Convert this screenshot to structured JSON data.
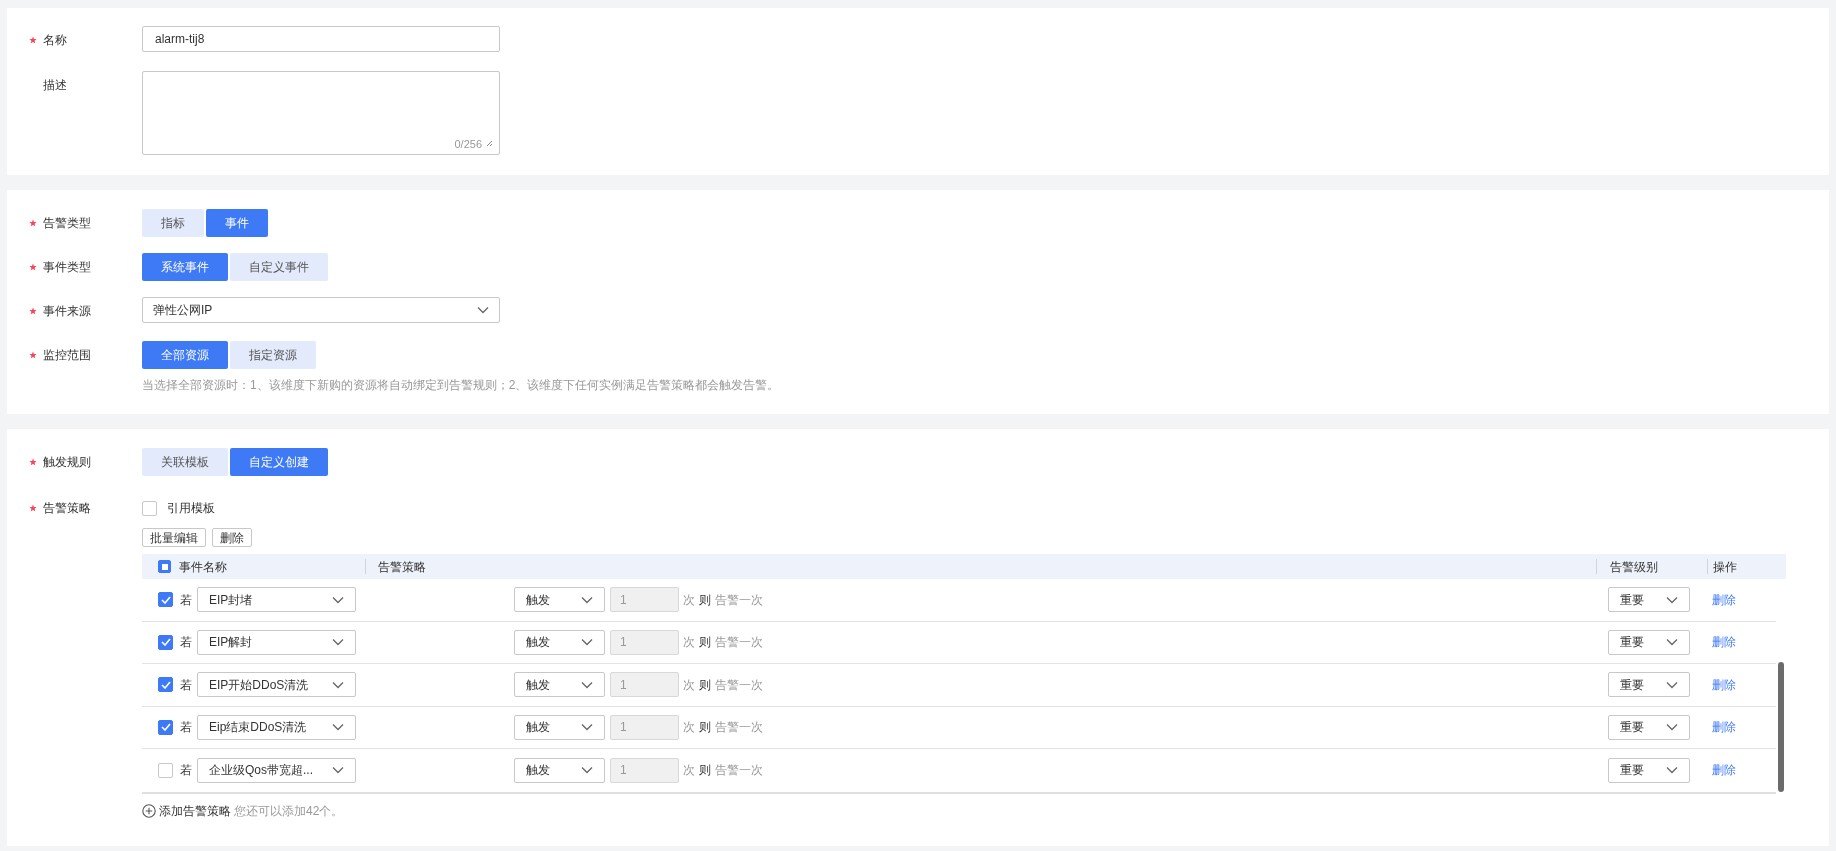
{
  "basic": {
    "name": {
      "label": "名称",
      "required": true,
      "value": "alarm-tij8"
    },
    "description": {
      "label": "描述",
      "required": false,
      "counter": "0/256"
    }
  },
  "scope": {
    "alarm_type": {
      "label": "告警类型",
      "required": true,
      "options": [
        {
          "label": "指标",
          "selected": false
        },
        {
          "label": "事件",
          "selected": true
        }
      ]
    },
    "event_type": {
      "label": "事件类型",
      "required": true,
      "options": [
        {
          "label": "系统事件",
          "selected": true
        },
        {
          "label": "自定义事件",
          "selected": false
        }
      ]
    },
    "event_source": {
      "label": "事件来源",
      "required": true,
      "value": "弹性公网IP"
    },
    "monitor_scope": {
      "label": "监控范围",
      "required": true,
      "options": [
        {
          "label": "全部资源",
          "selected": true
        },
        {
          "label": "指定资源",
          "selected": false
        }
      ],
      "hint": "当选择全部资源时：1、该维度下新购的资源将自动绑定到告警规则；2、该维度下任何实例满足告警策略都会触发告警。"
    }
  },
  "rules": {
    "trigger_rule": {
      "label": "触发规则",
      "required": true,
      "options": [
        {
          "label": "关联模板",
          "selected": false
        },
        {
          "label": "自定义创建",
          "selected": true
        }
      ]
    },
    "policy": {
      "label": "告警策略",
      "required": true,
      "use_template": {
        "label": "引用模板",
        "checked": false
      },
      "buttons": [
        "批量编辑",
        "删除"
      ],
      "table": {
        "select_all": {
          "indeterminate": true
        },
        "columns": [
          "事件名称",
          "告警策略",
          "告警级别",
          "操作"
        ],
        "rows": [
          {
            "checked": true,
            "prefix": "若",
            "event": "EIP封堵",
            "trigger": "触发",
            "count": "1",
            "unit": "次",
            "then": "则",
            "action_text": "告警一次",
            "level": "重要",
            "delete": "删除"
          },
          {
            "checked": true,
            "prefix": "若",
            "event": "EIP解封",
            "trigger": "触发",
            "count": "1",
            "unit": "次",
            "then": "则",
            "action_text": "告警一次",
            "level": "重要",
            "delete": "删除"
          },
          {
            "checked": true,
            "prefix": "若",
            "event": "EIP开始DDoS清洗",
            "trigger": "触发",
            "count": "1",
            "unit": "次",
            "then": "则",
            "action_text": "告警一次",
            "level": "重要",
            "delete": "删除"
          },
          {
            "checked": true,
            "prefix": "若",
            "event": "Eip结束DDoS清洗",
            "trigger": "触发",
            "count": "1",
            "unit": "次",
            "then": "则",
            "action_text": "告警一次",
            "level": "重要",
            "delete": "删除"
          },
          {
            "checked": false,
            "prefix": "若",
            "event": "企业级Qos带宽超...",
            "trigger": "触发",
            "count": "1",
            "unit": "次",
            "then": "则",
            "action_text": "告警一次",
            "level": "重要",
            "delete": "删除"
          }
        ]
      },
      "add": {
        "label": "添加告警策略",
        "note": "您还可以添加42个。"
      }
    }
  }
}
